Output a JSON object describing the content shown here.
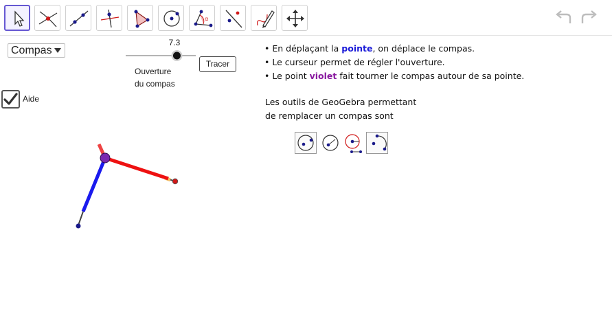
{
  "toolbar": {
    "tools": [
      {
        "name": "move-tool-icon",
        "selected": true
      },
      {
        "name": "intersect-tool-icon",
        "selected": false
      },
      {
        "name": "line-tool-icon",
        "selected": false
      },
      {
        "name": "perpendicular-tool-icon",
        "selected": false
      },
      {
        "name": "polygon-tool-icon",
        "selected": false
      },
      {
        "name": "circle-tool-icon",
        "selected": false
      },
      {
        "name": "angle-tool-icon",
        "selected": false
      },
      {
        "name": "reflect-tool-icon",
        "selected": false
      },
      {
        "name": "pen-tool-icon",
        "selected": false
      },
      {
        "name": "move-graphics-view-icon",
        "selected": false
      }
    ],
    "accent_color": "#6557d2"
  },
  "controls": {
    "dropdown_value": "Compas",
    "slider_value": "7.3",
    "slider_fraction": 0.73,
    "slider_caption_line1": "Ouverture",
    "slider_caption_line2": "du compas",
    "trace_button": "Tracer",
    "checkbox_checked": true,
    "checkbox_label": "Aide"
  },
  "help": {
    "line1_before": "En déplaçant la ",
    "line1_highlight": "pointe",
    "line1_after": ",  on déplace le compas.",
    "line2": "Le curseur permet de régler l'ouverture.",
    "line3_before": "Le point ",
    "line3_highlight": "violet",
    "line3_after": " fait tourner le compas autour de sa pointe.",
    "para_line1": "Les outils de GeoGebra permettant",
    "para_line2": "de remplacer un compas sont"
  },
  "colors": {
    "leg_blue": "#1a1aee",
    "leg_red": "#ee1111",
    "pivot_violet": "#7a28b0",
    "point_dark_blue": "#1a1a8a"
  }
}
